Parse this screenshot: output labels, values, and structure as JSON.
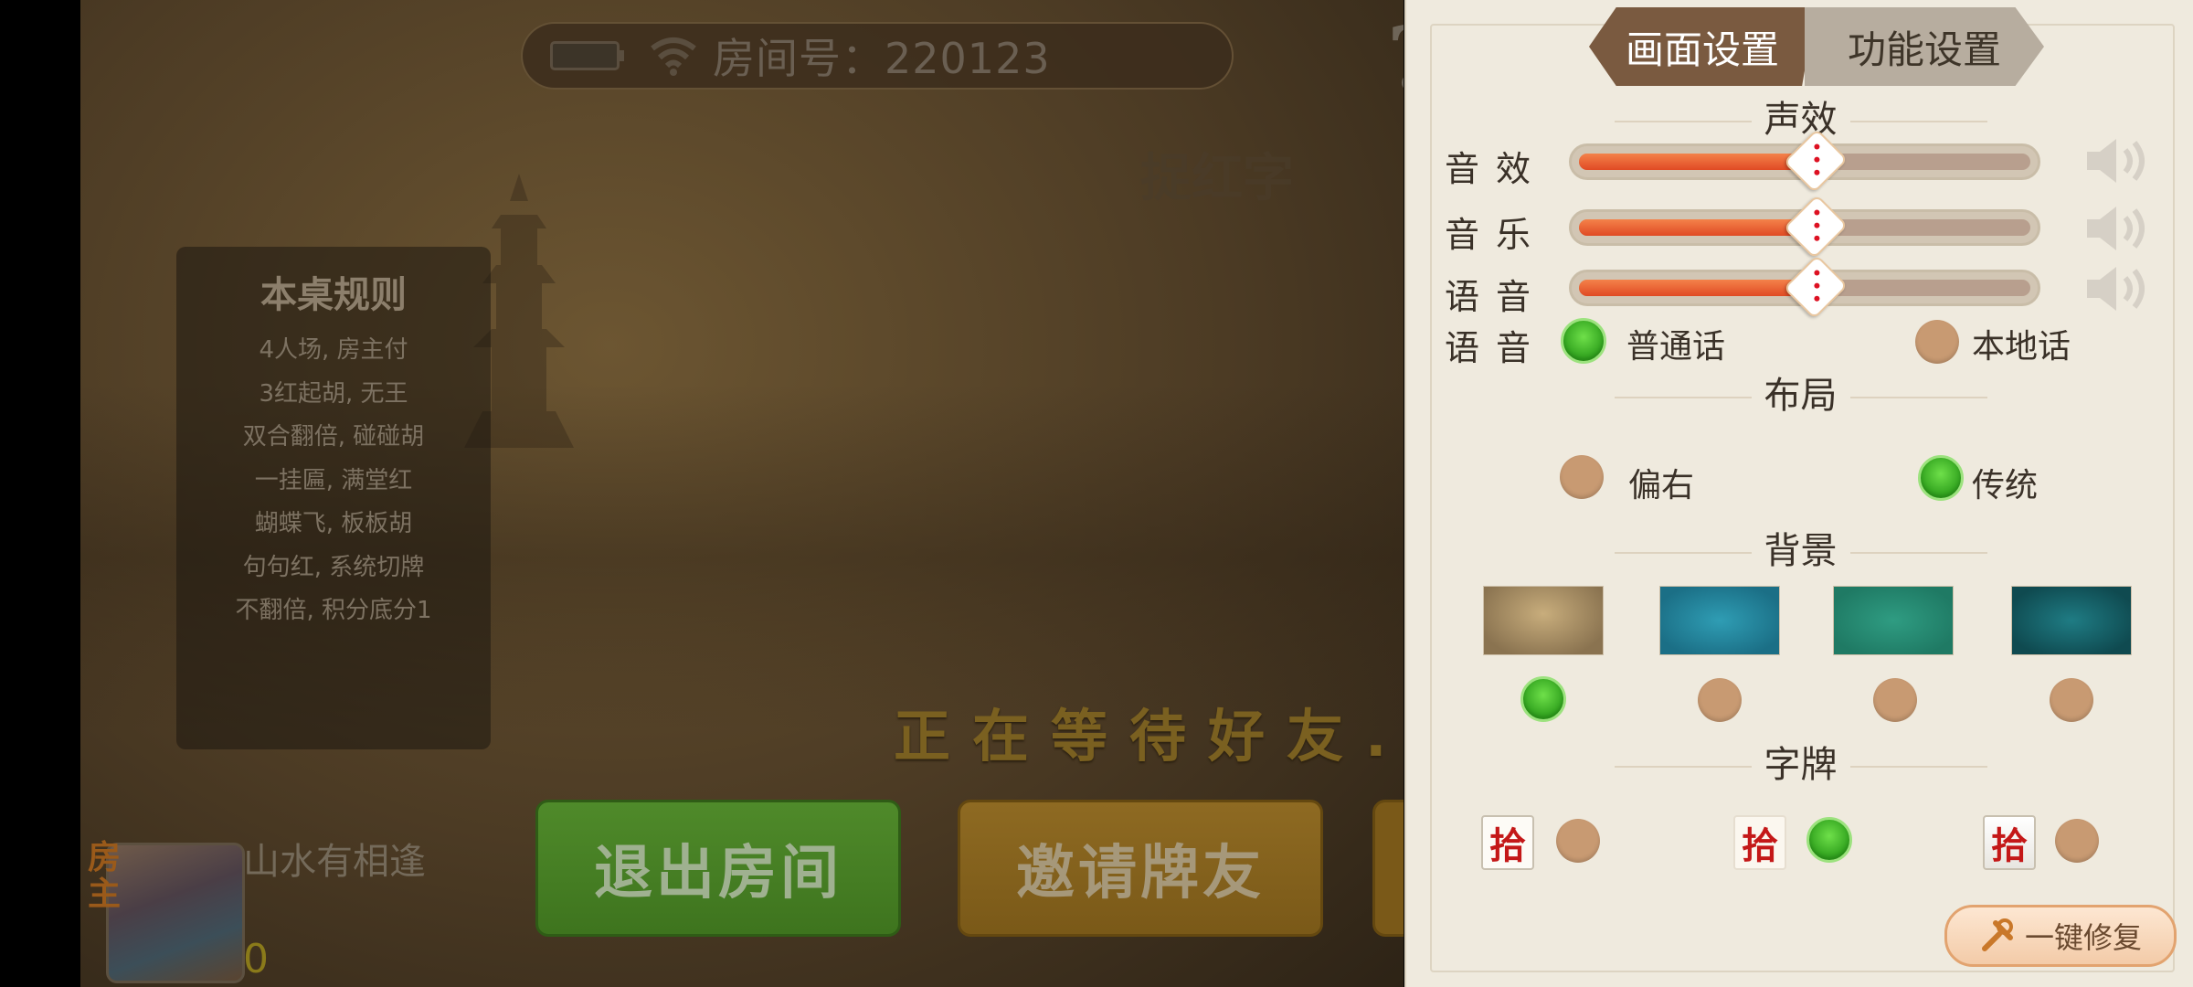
{
  "topbar": {
    "room_label": "房间号：220123"
  },
  "help": {
    "glyph": "?"
  },
  "title_mark": "捉红字",
  "rules": {
    "title": "本桌规则",
    "lines": [
      "4人场, 房主付",
      "3红起胡, 无王",
      "双合翻倍, 碰碰胡",
      "一挂匾, 满堂红",
      "蝴蝶飞, 板板胡",
      "句句红, 系统切牌",
      "不翻倍, 积分底分1"
    ]
  },
  "waiting_text": "正在等待好友...",
  "buttons": {
    "exit": "退出房间",
    "invite": "邀请牌友"
  },
  "player": {
    "host_badge": "房主",
    "name": "山水有相逢",
    "score": "0"
  },
  "settings": {
    "tabs": {
      "display": "画面设置",
      "function": "功能设置"
    },
    "sections": {
      "sound": "声效",
      "layout": "布局",
      "background": "背景",
      "tiles": "字牌"
    },
    "sound_rows": [
      {
        "label": "音效",
        "level": 0.52
      },
      {
        "label": "音乐",
        "level": 0.52
      },
      {
        "label": "语音",
        "level": 0.52
      }
    ],
    "voice": {
      "label": "语音",
      "options": [
        "普通话",
        "本地话"
      ],
      "selected": 0
    },
    "layout": {
      "options": [
        "偏右",
        "传统"
      ],
      "selected": 1
    },
    "background": {
      "selected": 0,
      "colors": [
        "#8a7350",
        "#1b6f86",
        "#1f7a64",
        "#0f4a50"
      ]
    },
    "tiles": {
      "glyph": "拾",
      "selected": 1
    },
    "fix_button": "一键修复"
  },
  "colors": {
    "accent_green": "#2ea01c",
    "tab_active": "#7a5a40",
    "slider_fill": "#e04a24"
  }
}
